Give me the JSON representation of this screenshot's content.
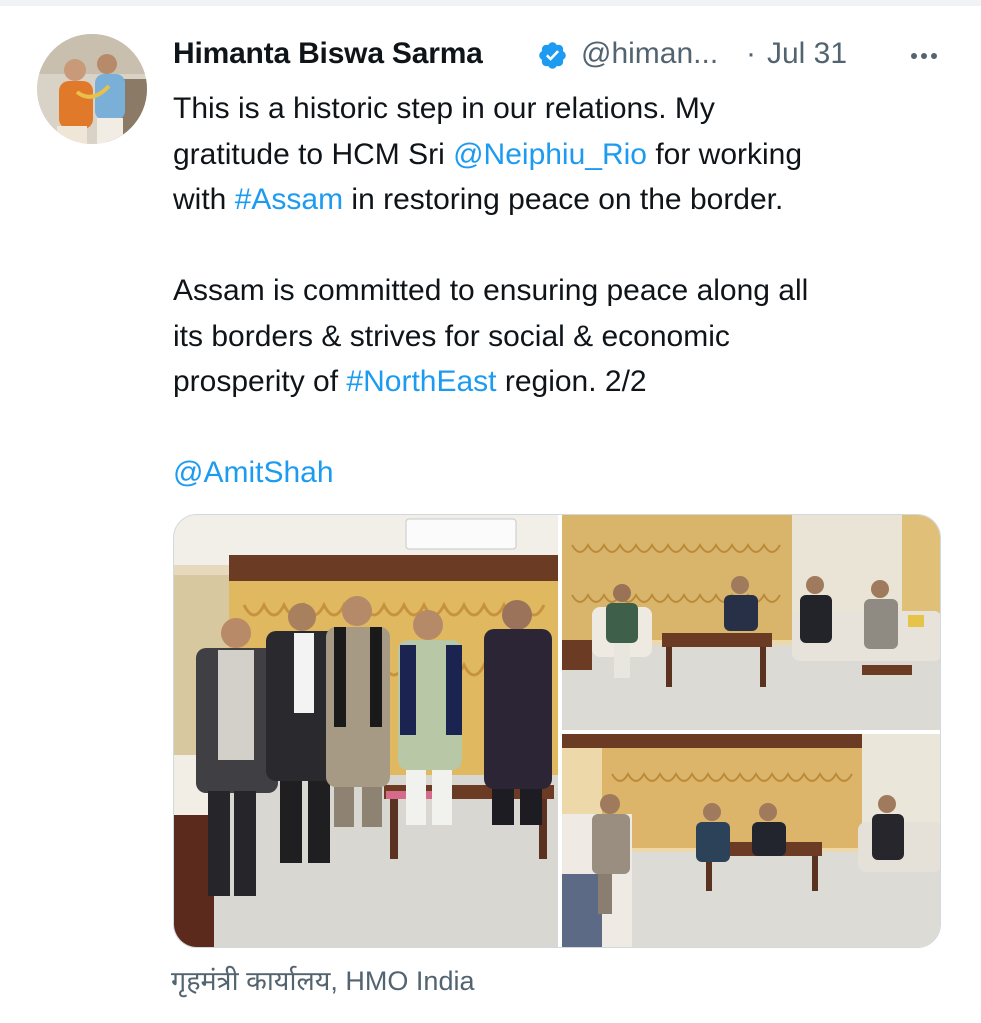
{
  "tweet": {
    "author_name": "Himanta Biswa Sarma",
    "handle": "@himan...",
    "separator": "·",
    "date": "Jul 31",
    "lines": [
      [
        {
          "t": "This is a historic step in our relations. My"
        }
      ],
      [
        {
          "t": "gratitude to HCM Sri "
        },
        {
          "t": "@Neiphiu_Rio",
          "link": true
        },
        {
          "t": " for working"
        }
      ],
      [
        {
          "t": "with "
        },
        {
          "t": "#Assam",
          "link": true
        },
        {
          "t": " in restoring peace on the border."
        }
      ],
      [],
      [
        {
          "t": "Assam is committed to ensuring peace along all"
        }
      ],
      [
        {
          "t": "its borders & strives for social & economic"
        }
      ],
      [
        {
          "t": "prosperity of "
        },
        {
          "t": "#NorthEast",
          "link": true
        },
        {
          "t": " region. 2/2"
        }
      ],
      [],
      [
        {
          "t": "@AmitShah",
          "link": true
        }
      ]
    ],
    "media_source": "गृहमंत्री कार्यालय, HMO India"
  },
  "icons": {
    "verified": "verified-badge-icon",
    "more": "more-options-icon"
  },
  "colors": {
    "link": "#1d9bf0",
    "secondary_text": "#536471",
    "primary_text": "#0f1419",
    "verified": "#1d9bf0",
    "media_border": "#cfd9de"
  }
}
